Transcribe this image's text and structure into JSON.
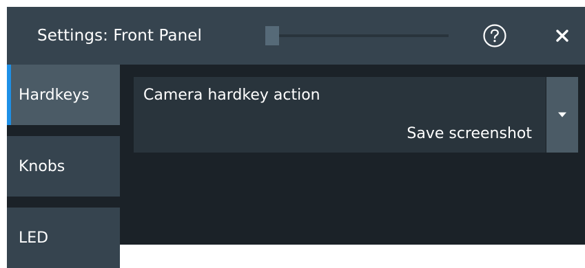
{
  "window": {
    "title": "Settings: Front Panel",
    "help_icon": "question-circle-icon",
    "close_icon": "close-x-icon"
  },
  "sidebar": {
    "items": [
      {
        "label": "Hardkeys",
        "active": true
      },
      {
        "label": "Knobs",
        "active": false
      },
      {
        "label": "LED",
        "active": false
      }
    ]
  },
  "setting": {
    "label": "Camera hardkey action",
    "value": "Save screenshot",
    "dropdown_icon": "caret-down-icon"
  },
  "colors": {
    "titlebar": "#36444f",
    "background": "#1b2228",
    "sidebar_item": "#36444f",
    "sidebar_active": "#4b5b66",
    "accent": "#1e90e6",
    "field": "#29343c"
  }
}
